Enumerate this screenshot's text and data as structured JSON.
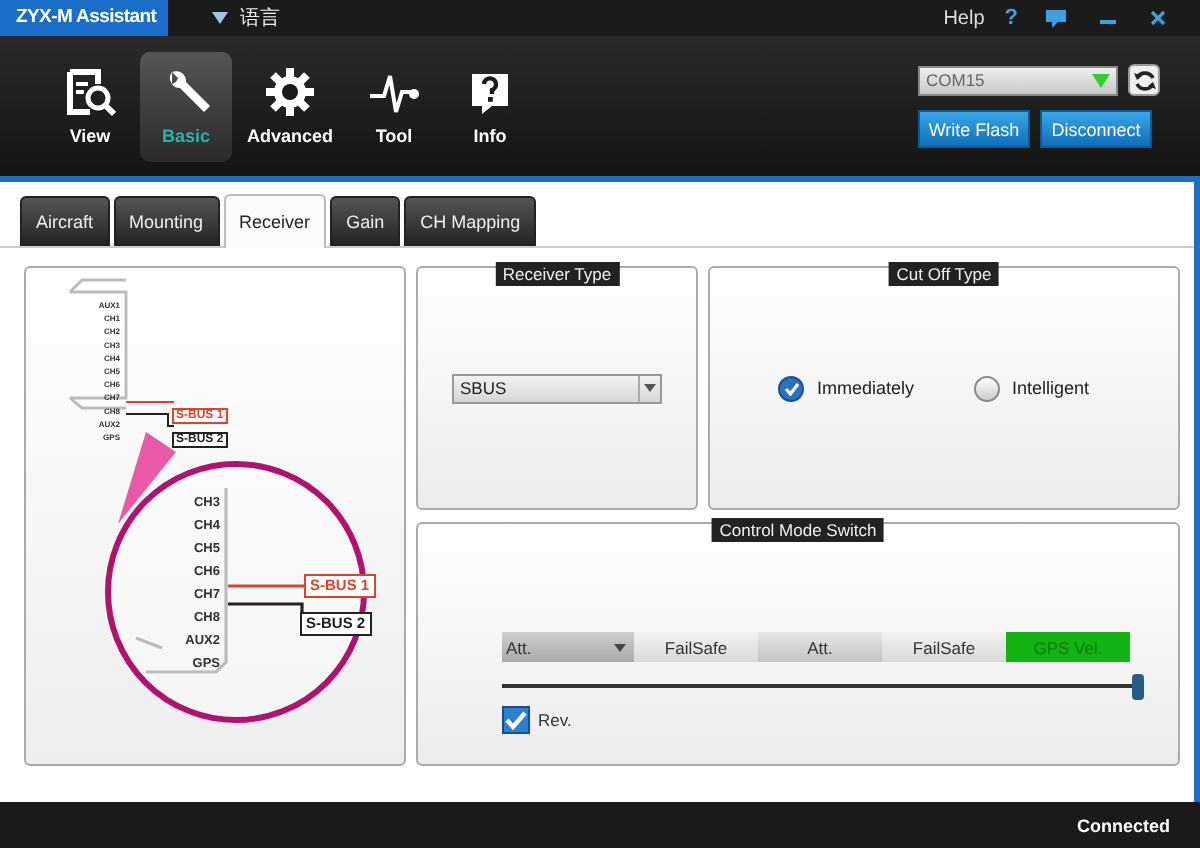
{
  "window": {
    "title": "ZYX-M Assistant",
    "language": "语言",
    "help": "Help",
    "help_glyph": "?"
  },
  "nav": [
    {
      "label": "View",
      "selected": false
    },
    {
      "label": "Basic",
      "selected": true
    },
    {
      "label": "Advanced",
      "selected": false
    },
    {
      "label": "Tool",
      "selected": false
    },
    {
      "label": "Info",
      "selected": false
    }
  ],
  "port": {
    "value": "COM15"
  },
  "buttons": [
    "Write Flash",
    "Disconnect"
  ],
  "tabs": [
    {
      "label": "Aircraft",
      "selected": false
    },
    {
      "label": "Mounting",
      "selected": false
    },
    {
      "label": "Receiver",
      "selected": true
    },
    {
      "label": "Gain",
      "selected": false
    },
    {
      "label": "CH Mapping",
      "selected": false
    }
  ],
  "diagram": {
    "pins": [
      "AUX1",
      "CH1",
      "CH2",
      "CH3",
      "CH4",
      "CH5",
      "CH6",
      "CH7",
      "CH8",
      "AUX2",
      "GPS"
    ],
    "zoom_pins": [
      "CH3",
      "CH4",
      "CH5",
      "CH6",
      "CH7",
      "CH8",
      "AUX2",
      "GPS"
    ],
    "outputs": [
      {
        "label": "S-BUS 1",
        "color": "#d9452f"
      },
      {
        "label": "S-BUS 2",
        "color": "#222222"
      }
    ],
    "zoom_outputs": [
      {
        "label": "S-BUS 1",
        "color": "#d9452f"
      },
      {
        "label": "S-BUS 2",
        "color": "#222222"
      }
    ]
  },
  "receiver_type": {
    "title": "Receiver Type",
    "value": "SBUS"
  },
  "cut_off_type": {
    "title": "Cut Off Type",
    "options": [
      {
        "label": "Immediately",
        "selected": true
      },
      {
        "label": "Intelligent",
        "selected": false
      }
    ]
  },
  "control_mode_switch": {
    "title": "Control Mode Switch",
    "segments": [
      {
        "kind": "dropdown",
        "label": "Att.",
        "selected": false
      },
      {
        "kind": "segment",
        "label": "FailSafe",
        "selected": false
      },
      {
        "kind": "segment",
        "label": "Att.",
        "selected": false
      },
      {
        "kind": "segment",
        "label": "FailSafe",
        "selected": false
      },
      {
        "kind": "segment",
        "label": "GPS Vel.",
        "selected": true
      }
    ],
    "slider": {
      "level": 0.99
    },
    "reverse": {
      "label": "Rev.",
      "checked": true
    }
  },
  "status_bar": {
    "text": "Connected"
  }
}
